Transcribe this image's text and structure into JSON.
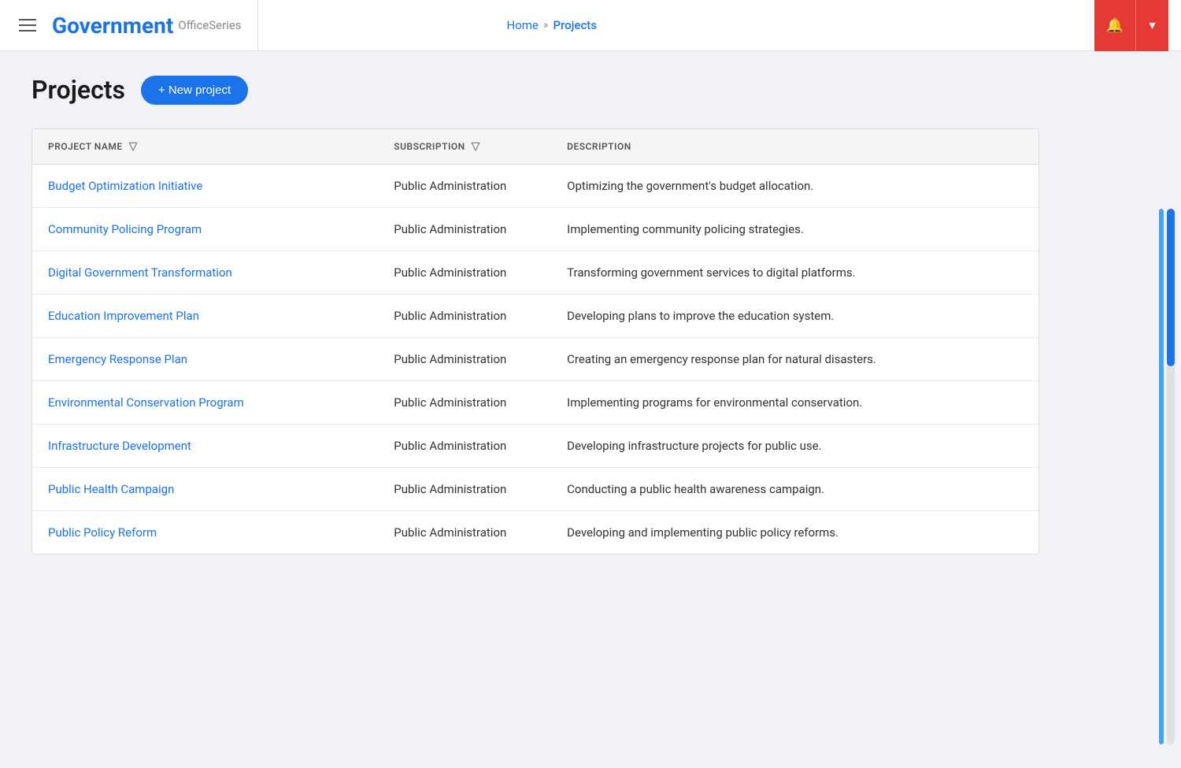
{
  "header": {
    "menu_label": "Menu",
    "logo_title": "Government",
    "logo_subtitle": "OfficeSeries",
    "nav_home": "Home",
    "nav_separator": "»",
    "nav_current": "Projects",
    "bell_icon": "🔔",
    "dropdown_icon": "▾"
  },
  "page": {
    "title": "Projects",
    "new_project_label": "+ New project"
  },
  "table": {
    "columns": [
      {
        "id": "name",
        "label": "PROJECT NAME",
        "filterable": true
      },
      {
        "id": "subscription",
        "label": "SUBSCRIPTION",
        "filterable": true
      },
      {
        "id": "description",
        "label": "DESCRIPTION",
        "filterable": false
      }
    ],
    "rows": [
      {
        "name": "Budget Optimization Initiative",
        "subscription": "Public Administration",
        "description": "Optimizing the government's budget allocation."
      },
      {
        "name": "Community Policing Program",
        "subscription": "Public Administration",
        "description": "Implementing community policing strategies."
      },
      {
        "name": "Digital Government Transformation",
        "subscription": "Public Administration",
        "description": "Transforming government services to digital platforms."
      },
      {
        "name": "Education Improvement Plan",
        "subscription": "Public Administration",
        "description": "Developing plans to improve the education system."
      },
      {
        "name": "Emergency Response Plan",
        "subscription": "Public Administration",
        "description": "Creating an emergency response plan for natural disasters."
      },
      {
        "name": "Environmental Conservation Program",
        "subscription": "Public Administration",
        "description": "Implementing programs for environmental conservation."
      },
      {
        "name": "Infrastructure Development",
        "subscription": "Public Administration",
        "description": "Developing infrastructure projects for public use."
      },
      {
        "name": "Public Health Campaign",
        "subscription": "Public Administration",
        "description": "Conducting a public health awareness campaign."
      },
      {
        "name": "Public Policy Reform",
        "subscription": "Public Administration",
        "description": "Developing and implementing public policy reforms."
      }
    ]
  }
}
